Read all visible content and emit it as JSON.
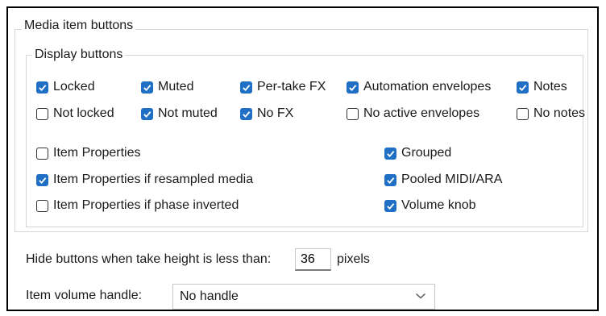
{
  "group": {
    "title": "Media item buttons",
    "display": {
      "title": "Display buttons",
      "checkboxes": [
        {
          "label": "Locked",
          "checked": true
        },
        {
          "label": "Muted",
          "checked": true
        },
        {
          "label": "Per-take FX",
          "checked": true
        },
        {
          "label": "Automation envelopes",
          "checked": true
        },
        {
          "label": "Notes",
          "checked": true
        },
        {
          "label": "Not locked",
          "checked": false
        },
        {
          "label": "Not muted",
          "checked": true
        },
        {
          "label": "No FX",
          "checked": true
        },
        {
          "label": "No active envelopes",
          "checked": false
        },
        {
          "label": "No notes",
          "checked": false
        },
        {
          "label": "Item Properties",
          "checked": false
        },
        {
          "label": "Item Properties if resampled media",
          "checked": true
        },
        {
          "label": "Item Properties if phase inverted",
          "checked": false
        },
        {
          "label": "Grouped",
          "checked": true
        },
        {
          "label": "Pooled MIDI/ARA",
          "checked": true
        },
        {
          "label": "Volume knob",
          "checked": true
        }
      ]
    }
  },
  "hide": {
    "label": "Hide buttons when take height is less than:",
    "value": "36",
    "unit": "pixels"
  },
  "volume_handle": {
    "label": "Item volume handle:",
    "selected": "No handle"
  },
  "colors": {
    "accent": "#1f6fc5",
    "groupbox_border": "#d6d6d6"
  }
}
